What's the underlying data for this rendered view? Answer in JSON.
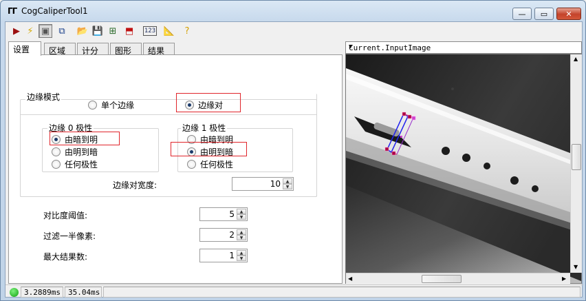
{
  "window": {
    "title": "CogCaliperTool1",
    "app_icon": "ff-icon",
    "minimize_icon": "minimize-icon",
    "maximize_icon": "maximize-icon",
    "close_icon": "close-icon",
    "close_glyph": "✕",
    "maximize_glyph": "▭",
    "minimize_glyph": "—",
    "app_glyph": "ΓΓ"
  },
  "toolbar": [
    {
      "name": "run-icon",
      "glyph": "▶",
      "color": "#9c1010"
    },
    {
      "name": "electric-icon",
      "glyph": "⚡",
      "color": "#d4a800"
    },
    {
      "name": "live-display-icon",
      "glyph": "▣",
      "color": "#555555",
      "pressed": true
    },
    {
      "name": "show-graphics-icon",
      "glyph": "⧉",
      "color": "#1a3f8a"
    },
    {
      "name": "open-folder-icon",
      "glyph": "📂",
      "color": "#b58a00"
    },
    {
      "name": "save-icon",
      "glyph": "💾",
      "color": "#1a2f6a"
    },
    {
      "name": "grid-icon",
      "glyph": "⊞",
      "color": "#2a6a2a"
    },
    {
      "name": "load-image-icon",
      "glyph": "⬒",
      "color": "#c01010"
    },
    {
      "name": "numeric-123-icon",
      "glyph": "123",
      "color": "#203060"
    },
    {
      "name": "ruler-icon",
      "glyph": "📐",
      "color": "#605030"
    },
    {
      "name": "help-icon",
      "glyph": "?",
      "color": "#d4a000"
    }
  ],
  "tabs": [
    {
      "label": "设置",
      "active": true
    },
    {
      "label": "区域",
      "active": false
    },
    {
      "label": "计分",
      "active": false
    },
    {
      "label": "图形",
      "active": false
    },
    {
      "label": "结果",
      "active": false
    }
  ],
  "edge_mode": {
    "group_label": "边缘模式",
    "single_edge": "单个边缘",
    "edge_pair": "边缘对",
    "selected": "edge_pair"
  },
  "edge0": {
    "group_label": "边缘 0 极性",
    "options": [
      "由暗到明",
      "由明到暗",
      "任何极性"
    ],
    "selected_index": 0
  },
  "edge1": {
    "group_label": "边缘 1 极性",
    "options": [
      "由暗到明",
      "由明到暗",
      "任何极性"
    ],
    "selected_index": 1
  },
  "edge_pair_width": {
    "label": "边缘对宽度:",
    "value": "10"
  },
  "contrast_threshold": {
    "label": "对比度阈值:",
    "value": "5"
  },
  "filter_half_pixels": {
    "label": "过滤一半像素:",
    "value": "2"
  },
  "max_results": {
    "label": "最大结果数:",
    "value": "1"
  },
  "image_pane": {
    "selection": "Current.InputImage",
    "dropdown_icon": "dropdown-arrow-icon"
  },
  "status": {
    "time1": "3.2889ms",
    "time2": "35.04ms",
    "led_color": "#19b119"
  }
}
